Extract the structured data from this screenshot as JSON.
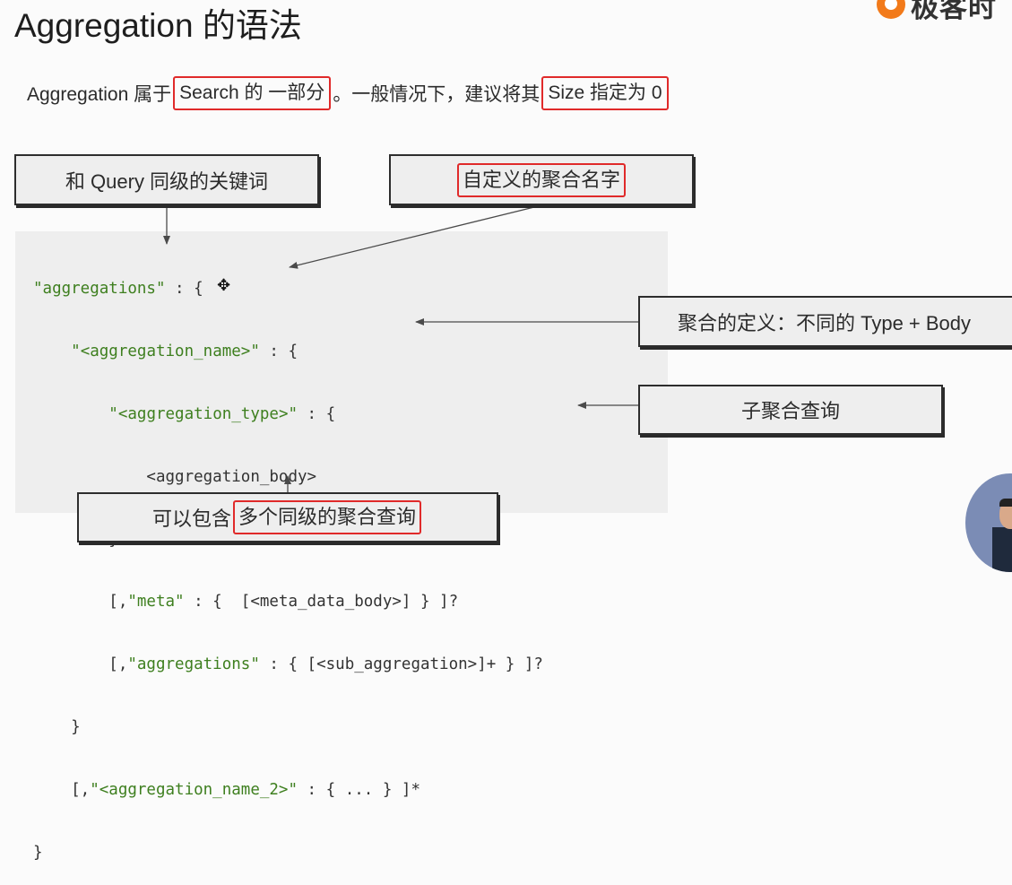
{
  "slide": {
    "title": "Aggregation 的语法",
    "logo_text": "极客时"
  },
  "subtitle": {
    "part1": "Aggregation 属于",
    "hl1": "Search 的 一部分",
    "part2": "。一般情况下，建议将其",
    "hl2": "Size 指定为 0"
  },
  "callouts": {
    "keyword": "和 Query 同级的关键词",
    "name": "自定义的聚合名字",
    "definition": "聚合的定义：不同的 Type + Body",
    "sub": "子聚合查询",
    "multi_prefix": "可以包含",
    "multi_hl": "多个同级的聚合查询"
  },
  "code": {
    "l1_str": "\"aggregations\"",
    "l1_rest": " : {",
    "l2_indent": "    ",
    "l2_str": "\"<aggregation_name>\"",
    "l2_rest": " : {",
    "l3_indent": "        ",
    "l3_str": "\"<aggregation_type>\"",
    "l3_rest": " : {",
    "l4": "            <aggregation_body>",
    "l5": "        }",
    "l6_pre": "        [,",
    "l6_str": "\"meta\"",
    "l6_rest": " : {  [<meta_data_body>] } ]?",
    "l7_pre": "        [,",
    "l7_str": "\"aggregations\"",
    "l7_rest": " : { [<sub_aggregation>]+ } ]?",
    "l8": "    }",
    "l9_pre": "    [,",
    "l9_str": "\"<aggregation_name_2>\"",
    "l9_rest": " : { ... } ]*",
    "l10": "}"
  },
  "colors": {
    "highlight_border": "#e02a2a",
    "code_string": "#3e7f1f",
    "panel_bg": "#eeeeee"
  }
}
